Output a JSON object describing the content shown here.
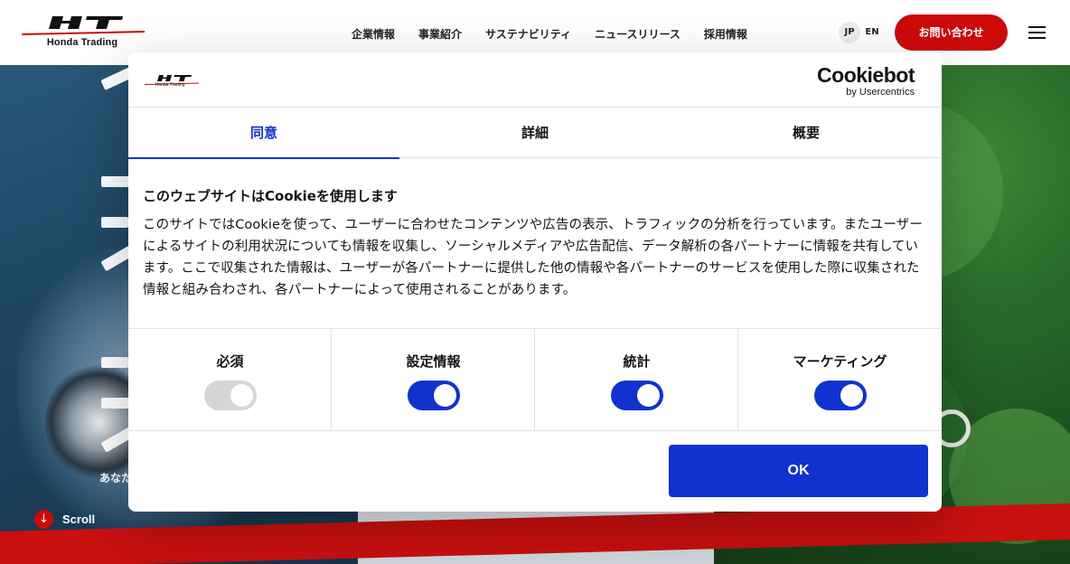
{
  "header": {
    "logo_text": "Honda Trading",
    "nav": [
      "企業情報",
      "事業紹介",
      "サステナビリティ",
      "ニュースリリース",
      "採用情報"
    ],
    "lang_jp": "JP",
    "lang_en": "EN",
    "contact_label": "お問い合わせ"
  },
  "hero": {
    "tagline": "あなた",
    "scroll_label": "Scroll"
  },
  "dialog": {
    "brand_name": "Cookiebot",
    "brand_by": "by Usercentrics",
    "logo_sub": "Honda Trading",
    "tabs": [
      {
        "label": "同意",
        "active": true
      },
      {
        "label": "詳細",
        "active": false
      },
      {
        "label": "概要",
        "active": false
      }
    ],
    "heading": "このウェブサイトはCookieを使用します",
    "body": "このサイトではCookieを使って、ユーザーに合わせたコンテンツや広告の表示、トラフィックの分析を行っています。またユーザーによるサイトの利用状況についても情報を収集し、ソーシャルメディアや広告配信、データ解析の各パートナーに情報を共有しています。ここで収集された情報は、ユーザーが各パートナーに提供した他の情報や各パートナーのサービスを使用した際に収集された情報と組み合わされ、各パートナーによって使用されることがあります。",
    "toggles": [
      {
        "label": "必須",
        "on": true,
        "disabled": true
      },
      {
        "label": "設定情報",
        "on": true,
        "disabled": false
      },
      {
        "label": "統計",
        "on": true,
        "disabled": false
      },
      {
        "label": "マーケティング",
        "on": true,
        "disabled": false
      }
    ],
    "ok_label": "OK"
  },
  "colors": {
    "brand_red": "#cc0a0a",
    "accent_blue": "#1032cf",
    "disabled_gray": "#d6d6d6"
  }
}
